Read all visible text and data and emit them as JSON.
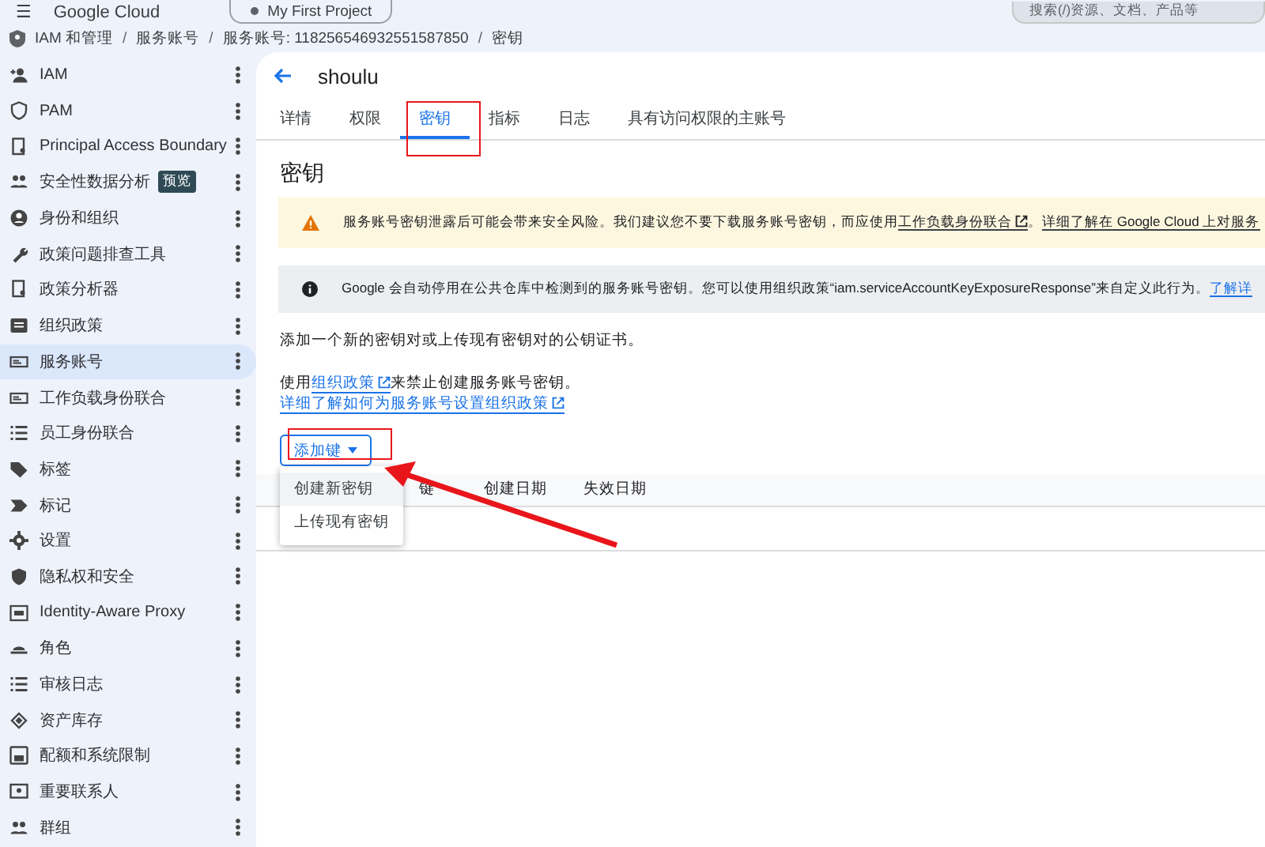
{
  "topbar": {
    "menu_icon": "☰",
    "product": "Google Cloud",
    "project": "My First Project",
    "search": {
      "placeholder": "搜索(/)资源、文档、产品等"
    }
  },
  "breadcrumb": [
    {
      "kind": "item",
      "text": "IAM 和管理"
    },
    {
      "kind": "separator",
      "text": "/"
    },
    {
      "kind": "item",
      "text": "服务账号"
    },
    {
      "kind": "separator",
      "text": "/"
    },
    {
      "kind": "item",
      "text": "服务账号: 118256546932551587850"
    },
    {
      "kind": "separator",
      "text": "/"
    },
    {
      "kind": "item",
      "text": "密钥"
    }
  ],
  "sidebar": {
    "items": [
      {
        "label": "IAM",
        "selected": false
      },
      {
        "label": "PAM",
        "selected": false
      },
      {
        "label": "Principal Access Boundary",
        "selected": false
      },
      {
        "label": "安全性数据分析",
        "badge": "预览",
        "selected": false
      },
      {
        "label": "身份和组织",
        "selected": false
      },
      {
        "label": "政策问题排查工具",
        "selected": false
      },
      {
        "label": "政策分析器",
        "selected": false
      },
      {
        "label": "组织政策",
        "selected": false
      },
      {
        "label": "服务账号",
        "selected": true
      },
      {
        "label": "工作负载身份联合",
        "selected": false
      },
      {
        "label": "员工身份联合",
        "selected": false
      },
      {
        "label": "标签",
        "selected": false
      },
      {
        "label": "标记",
        "selected": false
      },
      {
        "label": "设置",
        "selected": false
      },
      {
        "label": "隐私权和安全",
        "selected": false
      },
      {
        "label": "Identity-Aware Proxy",
        "selected": false
      },
      {
        "label": "角色",
        "selected": false
      },
      {
        "label": "审核日志",
        "selected": false
      },
      {
        "label": "资产库存",
        "selected": false
      },
      {
        "label": "配额和系统限制",
        "selected": false
      },
      {
        "label": "重要联系人",
        "selected": false
      },
      {
        "label": "群组",
        "selected": false
      }
    ]
  },
  "header": {
    "title": "shoulu"
  },
  "tabs": [
    {
      "label": "详情",
      "selected": false
    },
    {
      "label": "权限",
      "selected": false
    },
    {
      "label": "密钥",
      "selected": true
    },
    {
      "label": "指标",
      "selected": false
    },
    {
      "label": "日志",
      "selected": false
    },
    {
      "label": "具有访问权限的主账号",
      "selected": false
    }
  ],
  "section_title": "密钥",
  "banners": [
    {
      "kind": "warning",
      "parts": [
        {
          "kind": "text",
          "text": "服务账号密钥泄露后可能会带来安全风险。我们建议您不要下载服务账号密钥，而应使用"
        },
        {
          "kind": "link",
          "text": "工作负载身份联合"
        },
        {
          "kind": "text",
          "text": "。"
        },
        {
          "kind": "link",
          "text": "详细了解在 Google Cloud 上对服务"
        }
      ]
    },
    {
      "kind": "info",
      "parts": [
        {
          "kind": "text",
          "text": "Google 会自动停用在公共仓库中检测到的服务账号密钥。您可以使用组织政策“iam.serviceAccountKeyExposureResponse”来自定义此行为。"
        },
        {
          "kind": "bluelink",
          "text": "了解详"
        }
      ]
    }
  ],
  "description": "添加一个新的密钥对或上传现有密钥对的公钥证书。",
  "policy_line": {
    "before": "使用",
    "link": "组织政策",
    "after": "来禁止创建服务账号密钥。"
  },
  "policy_help_link": "详细了解如何为服务账号设置组织政策",
  "add_key_button": {
    "label": "添加键",
    "expanded": true
  },
  "add_key_menu": [
    {
      "label": "创建新密钥",
      "selected": true
    },
    {
      "label": "上传现有密钥",
      "selected": false
    }
  ],
  "table": {
    "columns": [
      "键",
      "创建日期",
      "失效日期"
    ]
  }
}
